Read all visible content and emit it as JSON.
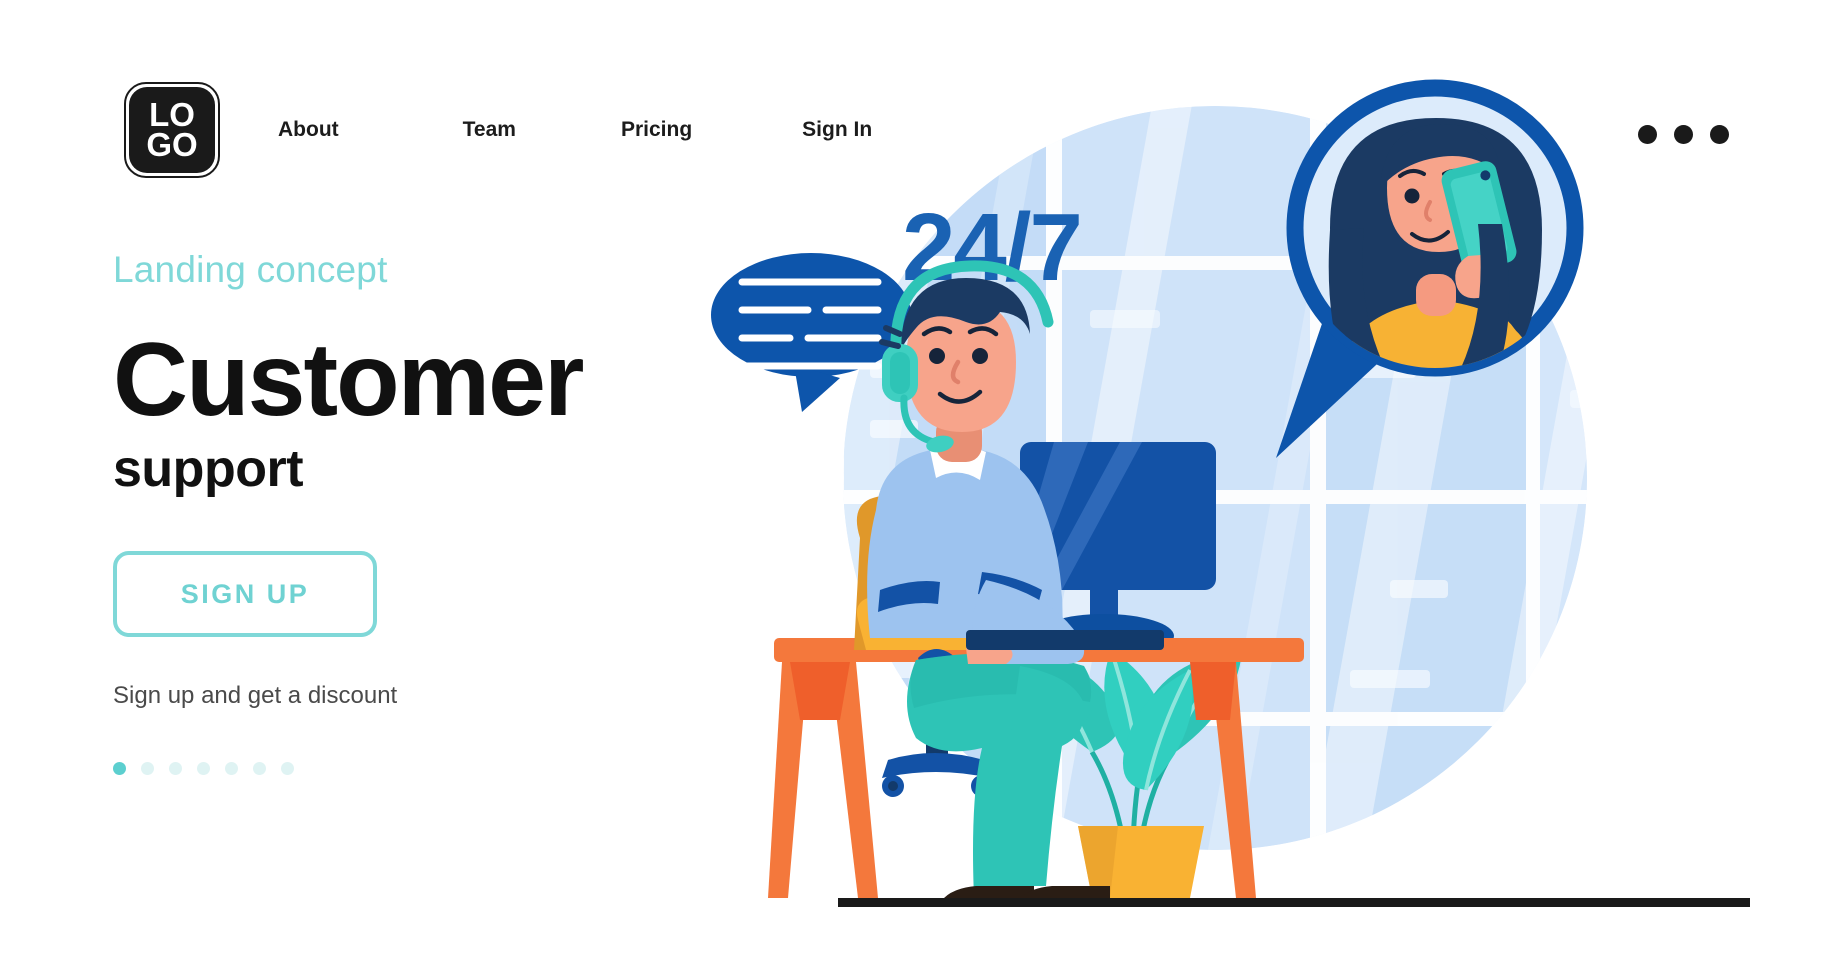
{
  "header": {
    "logo": {
      "line1": "LO",
      "line2": "GO",
      "name": "logo"
    },
    "nav": [
      {
        "label": "About"
      },
      {
        "label": "Team"
      },
      {
        "label": "Pricing"
      },
      {
        "label": "Sign In"
      }
    ],
    "menu_icon": "kebab-menu-icon"
  },
  "hero": {
    "eyebrow": "Landing concept",
    "title": "Customer",
    "subtitle": "support",
    "cta_label": "SIGN UP",
    "note": "Sign up and get a discount",
    "pagination": {
      "total": 7,
      "active_index": 0
    }
  },
  "illustration": {
    "badge_text": "24/7",
    "alt": "customer support agent with headset at desk and woman talking on phone",
    "elements": [
      "background-circle",
      "office-window",
      "chat-bubble",
      "avatar-circle-woman",
      "support-agent",
      "monitor",
      "desk",
      "office-chair",
      "potted-plant",
      "floor-line"
    ]
  },
  "colors": {
    "accent_teal": "#7fd8d8",
    "accent_teal_strong": "#5ccfcf",
    "ink": "#111111",
    "muted": "#4a4a4a",
    "brand_blue": "#1a62b3",
    "deep_blue": "#0d4fa0",
    "navy": "#123a6b",
    "sky": "#cfe3f7",
    "sky_light": "#e3eefb",
    "orange": "#f4783c",
    "orange_dark": "#ef5f2b",
    "amber": "#f9b233",
    "amber_dark": "#e0982a",
    "teal": "#2ec4b6",
    "teal_dark": "#1fb0a3",
    "skin": "#f7a48b",
    "hair_navy": "#1b3a63",
    "white": "#ffffff",
    "black": "#1a1a1a"
  }
}
